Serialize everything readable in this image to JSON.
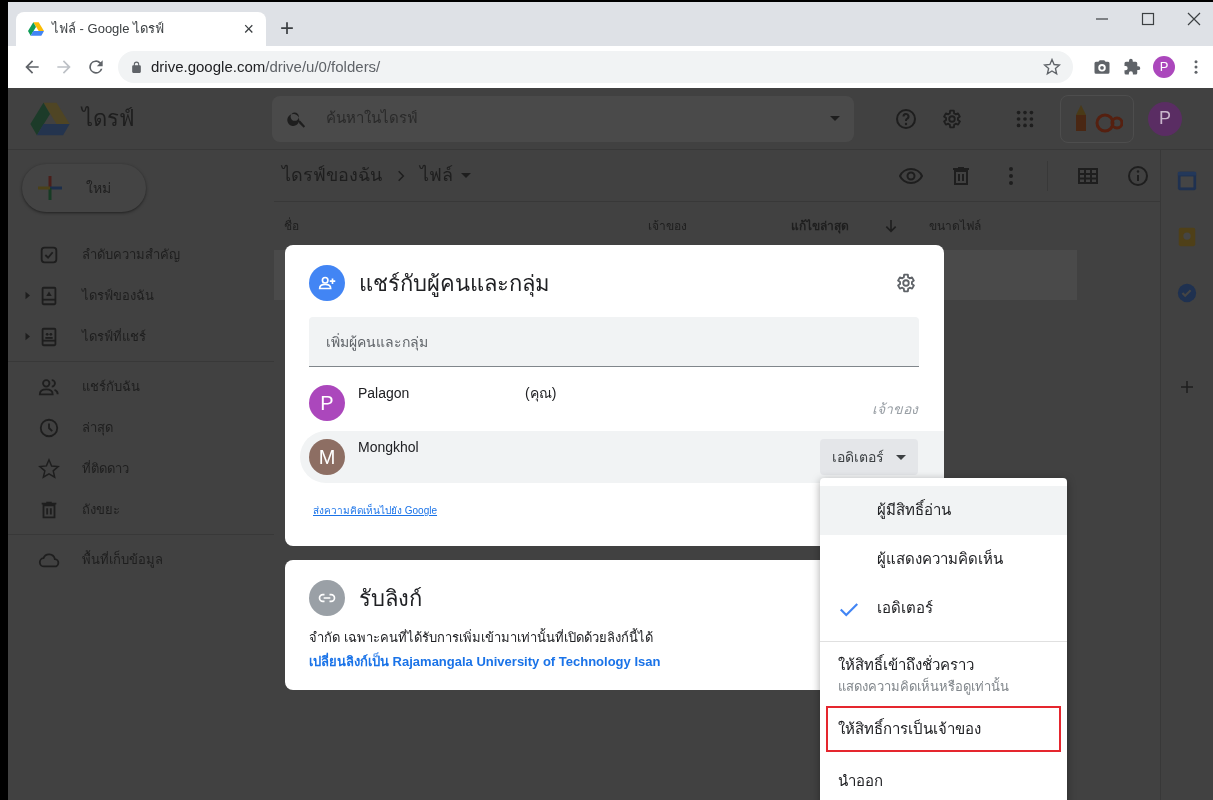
{
  "browser": {
    "tab": {
      "title": "ไฟล์ - Google ไดรฟ์",
      "close": "×"
    },
    "new_tab": "+",
    "url": {
      "host": "drive.google.com",
      "path": "/drive/u/0/folders/"
    },
    "profile": "P"
  },
  "app": {
    "name": "ไดรฟ์",
    "search": {
      "placeholder": "ค้นหาในไดรฟ์"
    },
    "avatar": "P"
  },
  "sidebar": {
    "new_button": "ใหม่",
    "sections": [
      [
        {
          "label": "ลำดับความสำคัญ",
          "expandable": false
        },
        {
          "label": "ไดรฟ์ของฉัน",
          "expandable": true
        },
        {
          "label": "ไดรฟ์ที่แชร์",
          "expandable": true
        }
      ],
      [
        {
          "label": "แชร์กับฉัน",
          "expandable": false
        },
        {
          "label": "ล่าสุด",
          "expandable": false
        },
        {
          "label": "ที่ติดดาว",
          "expandable": false
        },
        {
          "label": "ถังขยะ",
          "expandable": false
        }
      ],
      [
        {
          "label": "พื้นที่เก็บข้อมูล",
          "expandable": false
        }
      ]
    ]
  },
  "breadcrumb": [
    "ไดรฟ์ของฉัน",
    "ไฟล์"
  ],
  "columns": [
    {
      "label": "ชื่อ",
      "sorted": false
    },
    {
      "label": "เจ้าของ",
      "sorted": false
    },
    {
      "label": "แก้ไขล่าสุด",
      "sorted": true
    },
    {
      "label": "ขนาดไฟล์",
      "sorted": false
    }
  ],
  "share_dialog": {
    "title": "แชร์กับผู้คนและกลุ่ม",
    "input": {
      "placeholder": "เพิ่มผู้คนและกลุ่ม"
    },
    "people": [
      {
        "kind": "owner",
        "initial": "P",
        "name": "Palagon",
        "note": "(คุณ)",
        "role": "เจ้าของ",
        "color": "#ab47bc",
        "hovered": false
      },
      {
        "kind": "editor",
        "initial": "M",
        "name": "Mongkhol",
        "role": "เอดิเตอร์",
        "color": "#8d6e63",
        "hovered": true
      }
    ],
    "feedback_link": "ส่งความคิดเห็นไปยัง Google"
  },
  "link_dialog": {
    "title": "รับลิงก์",
    "description": "จำกัด เฉพาะคนที่ได้รับการเพิ่มเข้ามาเท่านั้นที่เปิดด้วยลิงก์นี้ได้",
    "change_link": "เปลี่ยนลิงก์เป็น Rajamangala University of Technology Isan"
  },
  "role_menu": {
    "items": [
      {
        "kind": "role",
        "label": "ผู้มีสิทธิ์อ่าน",
        "selected": false,
        "hovered": true
      },
      {
        "kind": "role",
        "label": "ผู้แสดงความคิดเห็น",
        "selected": false,
        "hovered": false
      },
      {
        "kind": "role",
        "label": "เอดิเตอร์",
        "selected": true,
        "hovered": false
      },
      {
        "kind": "action",
        "label": "ให้สิทธิ์เข้าถึงชั่วคราว",
        "subtitle": "แสดงความคิดเห็นหรือดูเท่านั้น",
        "outlined": false
      },
      {
        "kind": "action",
        "label": "ให้สิทธิ์การเป็นเจ้าของ",
        "outlined": true
      },
      {
        "kind": "action",
        "label": "นำออก",
        "outlined": false
      }
    ]
  }
}
